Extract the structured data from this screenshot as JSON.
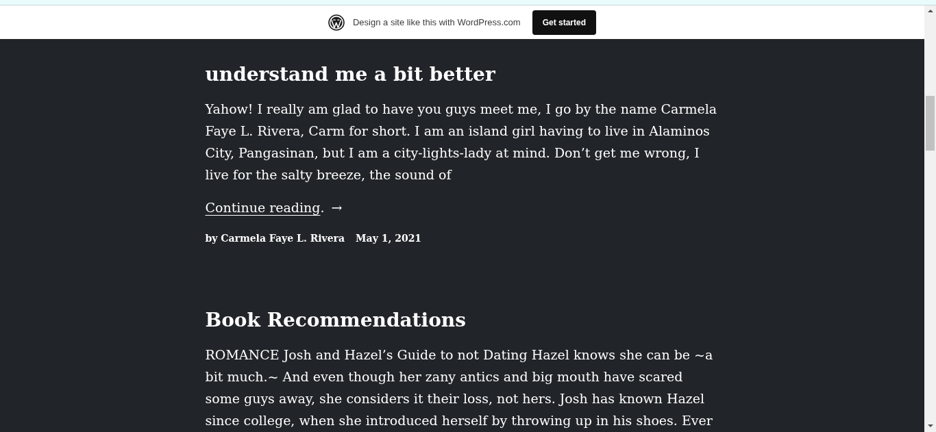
{
  "banner": {
    "text": "Design a site like this with WordPress.com",
    "button": "Get started"
  },
  "posts": [
    {
      "title": "understand me a bit better",
      "excerpt": "Yahow! I really am glad to have you guys meet me, I go by the name Carmela Faye L. Rivera, Carm for short. I am an island girl having to live in Alaminos City, Pangasinan, but I am a city-lights-lady at mind. Don’t get me wrong, I live for the salty breeze, the sound of",
      "more_link": "Continue reading",
      "more_dot": ".",
      "more_arrow": "→",
      "author": "by Carmela Faye L. Rivera",
      "date": "May 1, 2021"
    },
    {
      "title": "Book Recommendations",
      "excerpt": "ROMANCE Josh and Hazel’s Guide to not Dating Hazel knows she can be ~a bit much.~ And even though her zany antics and big mouth have scared some guys away, she considers it their loss, not hers. Josh has known Hazel since college, when she introduced herself by throwing up in his shoes. Ever"
    }
  ]
}
